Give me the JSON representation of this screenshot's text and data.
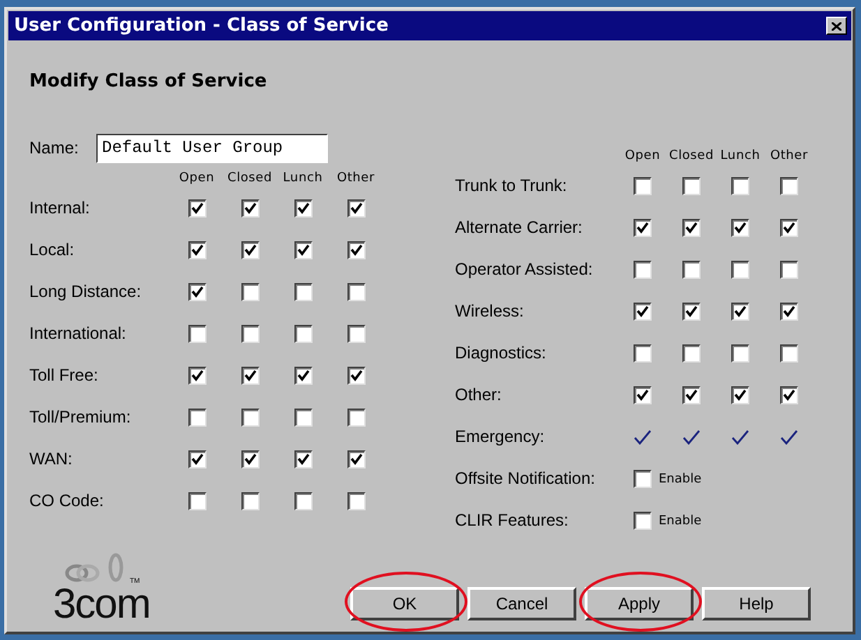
{
  "window": {
    "title": "User Configuration - Class of Service"
  },
  "heading": "Modify Class of Service",
  "name_field": {
    "label": "Name:",
    "value": "Default User Group"
  },
  "left": {
    "columns": [
      "Open",
      "Closed",
      "Lunch",
      "Other"
    ],
    "rows": [
      {
        "label": "Internal:",
        "kind": "checkboxes",
        "checked": [
          true,
          true,
          true,
          true
        ]
      },
      {
        "label": "Local:",
        "kind": "checkboxes",
        "checked": [
          true,
          true,
          true,
          true
        ]
      },
      {
        "label": "Long Distance:",
        "kind": "checkboxes",
        "checked": [
          true,
          false,
          false,
          false
        ]
      },
      {
        "label": "International:",
        "kind": "checkboxes",
        "checked": [
          false,
          false,
          false,
          false
        ]
      },
      {
        "label": "Toll Free:",
        "kind": "checkboxes",
        "checked": [
          true,
          true,
          true,
          true
        ]
      },
      {
        "label": "Toll/Premium:",
        "kind": "checkboxes",
        "checked": [
          false,
          false,
          false,
          false
        ]
      },
      {
        "label": "WAN:",
        "kind": "checkboxes",
        "checked": [
          true,
          true,
          true,
          true
        ]
      },
      {
        "label": "CO Code:",
        "kind": "checkboxes",
        "checked": [
          false,
          false,
          false,
          false
        ]
      }
    ]
  },
  "right": {
    "columns": [
      "Open",
      "Closed",
      "Lunch",
      "Other"
    ],
    "rows": [
      {
        "label": "Trunk to Trunk:",
        "kind": "checkboxes",
        "checked": [
          false,
          false,
          false,
          false
        ]
      },
      {
        "label": "Alternate Carrier:",
        "kind": "checkboxes",
        "checked": [
          true,
          true,
          true,
          true
        ]
      },
      {
        "label": "Operator Assisted:",
        "kind": "checkboxes",
        "checked": [
          false,
          false,
          false,
          false
        ]
      },
      {
        "label": "Wireless:",
        "kind": "checkboxes",
        "checked": [
          true,
          true,
          true,
          true
        ]
      },
      {
        "label": "Diagnostics:",
        "kind": "checkboxes",
        "checked": [
          false,
          false,
          false,
          false
        ]
      },
      {
        "label": "Other:",
        "kind": "checkboxes",
        "checked": [
          true,
          true,
          true,
          true
        ]
      },
      {
        "label": "Emergency:",
        "kind": "ticks",
        "checked": [
          true,
          true,
          true,
          true
        ]
      },
      {
        "label": "Offsite Notification:",
        "kind": "enable",
        "option": "Enable",
        "checked": false
      },
      {
        "label": "CLIR Features:",
        "kind": "enable",
        "option": "Enable",
        "checked": false
      }
    ]
  },
  "logo": {
    "text": "3com",
    "trademark": "TM"
  },
  "buttons": [
    {
      "label": "OK",
      "circled": true
    },
    {
      "label": "Cancel",
      "circled": false
    },
    {
      "label": "Apply",
      "circled": true
    },
    {
      "label": "Help",
      "circled": false
    }
  ]
}
